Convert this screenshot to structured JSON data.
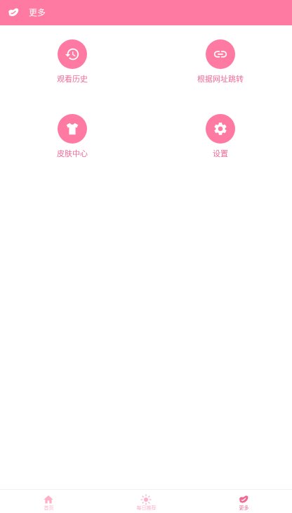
{
  "header": {
    "title": "更多",
    "logo_icon": "bean-logo-icon"
  },
  "grid": {
    "items": [
      {
        "label": "观看历史",
        "icon": "history-icon"
      },
      {
        "label": "根据网址跳转",
        "icon": "link-icon"
      },
      {
        "label": "皮肤中心",
        "icon": "tshirt-icon"
      },
      {
        "label": "设置",
        "icon": "gear-icon"
      }
    ]
  },
  "bottom_nav": {
    "items": [
      {
        "label": "首页",
        "icon": "home-icon",
        "active": false
      },
      {
        "label": "每日推荐",
        "icon": "sun-icon",
        "active": false
      },
      {
        "label": "更多",
        "icon": "bean-icon",
        "active": true
      }
    ]
  },
  "colors": {
    "accent": "#FF7AA2",
    "label": "#F06A95",
    "inactive": "#FFB0C8",
    "background": "#FFFFFF"
  }
}
